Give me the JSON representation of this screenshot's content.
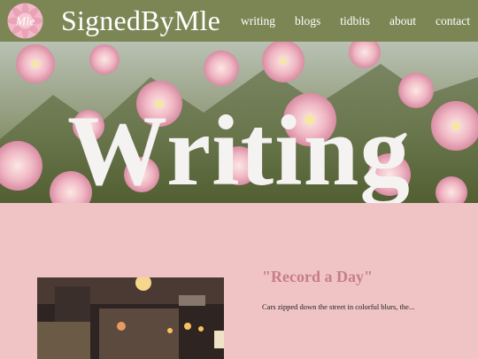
{
  "header": {
    "logo_text": "Mle",
    "brand": "SignedByMle",
    "nav": [
      {
        "label": "writing"
      },
      {
        "label": "blogs"
      },
      {
        "label": "tidbits"
      },
      {
        "label": "about"
      },
      {
        "label": "contact"
      }
    ]
  },
  "hero": {
    "title": "Writing"
  },
  "post": {
    "title": "\"Record a Day\"",
    "excerpt": "Cars zipped down the street in colorful blurs, the..."
  },
  "colors": {
    "nav_bg": "#7b8654",
    "page_bg": "#f0c4c5",
    "post_title": "#c77e86"
  }
}
